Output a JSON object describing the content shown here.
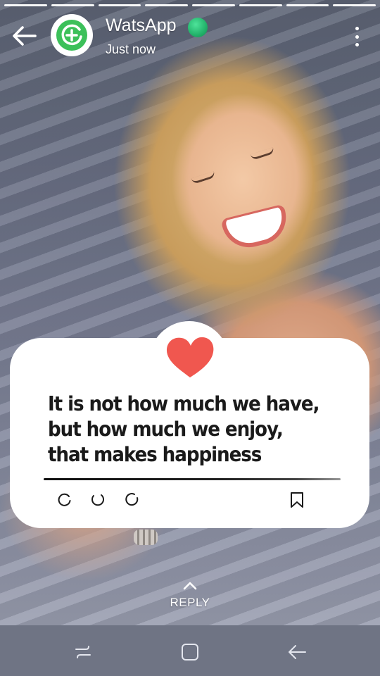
{
  "status": {
    "story_segments": 8
  },
  "header": {
    "title": "WatsApp",
    "subtitle": "Just now",
    "back_icon": "arrow-left-icon",
    "menu_icon": "more-vertical-icon",
    "avatar_icon": "add-status-icon",
    "online_color": "#22b26a"
  },
  "card": {
    "heart_color": "#f0574f",
    "quote_lines": [
      "It is not how much we have,",
      "but how much we enjoy,",
      "that makes happiness"
    ],
    "icons": [
      "circle-icon",
      "circle-icon",
      "circle-icon",
      "bookmark-icon"
    ]
  },
  "reply": {
    "label": "REPLY"
  },
  "navbar": {
    "recents_icon": "recents-icon",
    "home_icon": "home-icon",
    "back_icon": "back-icon"
  }
}
